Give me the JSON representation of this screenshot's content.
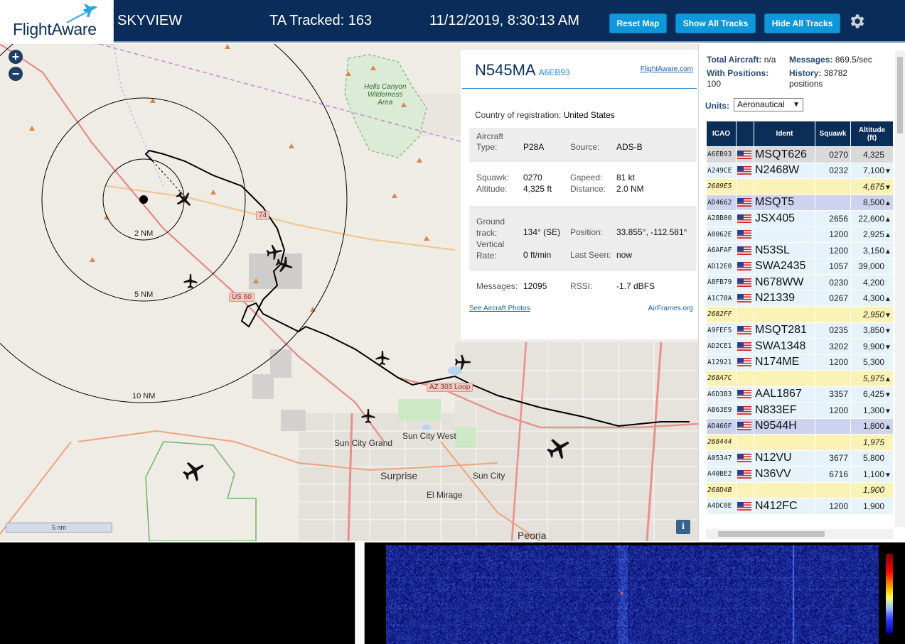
{
  "header": {
    "logo_text": "FlightAware",
    "app_name": "SKYVIEW",
    "tracked": "TA Tracked: 163",
    "datetime": "11/12/2019, 8:30:13 AM",
    "buttons": {
      "reset_map": "Reset Map",
      "show_all": "Show All Tracks",
      "hide_all": "Hide All Tracks"
    },
    "settings_icon": "gear-icon",
    "colors": {
      "bar": "#0a2c5a",
      "button": "#0f97dc"
    }
  },
  "map": {
    "zoom_in": "+",
    "zoom_out": "−",
    "range_rings": [
      "2 NM",
      "5 NM",
      "10 NM"
    ],
    "scale_label": "5 nm",
    "info_icon": "i",
    "labels": {
      "wilderness": "Hells Canyon\nWilderness\nArea",
      "sun_city_west": "Sun City West",
      "sun_city_grand": "Sun City Grand",
      "surprise": "Surprise",
      "sun_city": "Sun City",
      "el_mirage": "El Mirage",
      "peoria": "Peoria",
      "us60": "US 60",
      "az303": "AZ 303 Loop",
      "sr74": "74"
    }
  },
  "detail": {
    "callsign": "N545MA",
    "icao": "A6EB93",
    "link": "FlightAware.com",
    "country_label": "Country of registration:",
    "country": "United States",
    "aircraft_type_label": "Aircraft\nType:",
    "aircraft_type": "P28A",
    "source_label": "Source:",
    "source": "ADS-B",
    "squawk_label": "Squawk:",
    "squawk": "0270",
    "gspeed_label": "Gspeed:",
    "gspeed": "81 kt",
    "altitude_label": "Altitude:",
    "altitude": "4,325 ft",
    "distance_label": "Distance:",
    "distance": "2.0 NM",
    "ground_track_label": "Ground\ntrack:",
    "ground_track": "134° (SE)",
    "position_label": "Position:",
    "position": "33.855°, -112.581°",
    "vertical_rate_label": "Vertical\nRate:",
    "vertical_rate": "0 ft/min",
    "last_seen_label": "Last Seen:",
    "last_seen": "now",
    "messages_label": "Messages:",
    "messages": "12095",
    "rssi_label": "RSSI:",
    "rssi": "-1.7 dBFS",
    "photos_link": "See Aircraft Photos",
    "airframes_link": "AirFrames.org"
  },
  "sidebar": {
    "total_aircraft_label": "Total Aircraft:",
    "total_aircraft": "n/a",
    "messages_label": "Messages:",
    "messages": "869.5/sec",
    "with_positions_label": "With Positions:",
    "with_positions": "100",
    "history_label": "History:",
    "history": "38782\npositions",
    "units_label": "Units:",
    "units_value": "Aeronautical",
    "columns": [
      "ICAO",
      "",
      "Ident",
      "Squawk",
      "Altitude\n(ft)"
    ],
    "rows": [
      {
        "icao": "A6EB93",
        "flag": true,
        "ident": "MSQT626",
        "squawk": "0270",
        "alt": "4,325",
        "trend": "",
        "style": "sel"
      },
      {
        "icao": "A249CE",
        "flag": true,
        "ident": "N2468W",
        "squawk": "0232",
        "alt": "7,100",
        "trend": "▼",
        "style": "plain"
      },
      {
        "icao": "2689E5",
        "flag": false,
        "ident": "",
        "squawk": "",
        "alt": "4,675",
        "trend": "▼",
        "style": "yellow"
      },
      {
        "icao": "AD4662",
        "flag": true,
        "ident": "MSQT5",
        "squawk": "",
        "alt": "8,500",
        "trend": "▲",
        "style": "mlat"
      },
      {
        "icao": "A28B00",
        "flag": true,
        "ident": "JSX405",
        "squawk": "2656",
        "alt": "22,600",
        "trend": "▲",
        "style": "plain"
      },
      {
        "icao": "A0062E",
        "flag": true,
        "ident": "",
        "squawk": "1200",
        "alt": "2,925",
        "trend": "▲",
        "style": "plain"
      },
      {
        "icao": "A6AFAF",
        "flag": true,
        "ident": "N53SL",
        "squawk": "1200",
        "alt": "3,150",
        "trend": "▲",
        "style": "plain"
      },
      {
        "icao": "AD12E0",
        "flag": true,
        "ident": "SWA2435",
        "squawk": "1057",
        "alt": "39,000",
        "trend": "",
        "style": "plain"
      },
      {
        "icao": "A8FB79",
        "flag": true,
        "ident": "N678WW",
        "squawk": "0230",
        "alt": "4,200",
        "trend": "",
        "style": "plain"
      },
      {
        "icao": "A1C78A",
        "flag": true,
        "ident": "N21339",
        "squawk": "0267",
        "alt": "4,300",
        "trend": "▲",
        "style": "plain"
      },
      {
        "icao": "2682FF",
        "flag": false,
        "ident": "",
        "squawk": "",
        "alt": "2,950",
        "trend": "▼",
        "style": "yellow"
      },
      {
        "icao": "A9FEF5",
        "flag": true,
        "ident": "MSQT281",
        "squawk": "0235",
        "alt": "3,850",
        "trend": "▼",
        "style": "plain"
      },
      {
        "icao": "AD2CE1",
        "flag": true,
        "ident": "SWA1348",
        "squawk": "3202",
        "alt": "9,900",
        "trend": "▼",
        "style": "plain"
      },
      {
        "icao": "A12921",
        "flag": true,
        "ident": "N174ME",
        "squawk": "1200",
        "alt": "5,300",
        "trend": "",
        "style": "plain"
      },
      {
        "icao": "268A7C",
        "flag": false,
        "ident": "",
        "squawk": "",
        "alt": "5,975",
        "trend": "▲",
        "style": "yellow"
      },
      {
        "icao": "A6D3B3",
        "flag": true,
        "ident": "AAL1867",
        "squawk": "3357",
        "alt": "6,425",
        "trend": "▼",
        "style": "plain"
      },
      {
        "icao": "AB63E9",
        "flag": true,
        "ident": "N833EF",
        "squawk": "1200",
        "alt": "1,300",
        "trend": "▼",
        "style": "plain"
      },
      {
        "icao": "AD466F",
        "flag": true,
        "ident": "N9544H",
        "squawk": "",
        "alt": "1,800",
        "trend": "▲",
        "style": "mlat"
      },
      {
        "icao": "268444",
        "flag": false,
        "ident": "",
        "squawk": "",
        "alt": "1,975",
        "trend": "",
        "style": "yellow"
      },
      {
        "icao": "A05347",
        "flag": true,
        "ident": "N12VU",
        "squawk": "3677",
        "alt": "5,800",
        "trend": "",
        "style": "plain"
      },
      {
        "icao": "A40BE2",
        "flag": true,
        "ident": "N36VV",
        "squawk": "6716",
        "alt": "1,100",
        "trend": "▼",
        "style": "plain"
      },
      {
        "icao": "268D4B",
        "flag": false,
        "ident": "",
        "squawk": "",
        "alt": "1,900",
        "trend": "",
        "style": "yellow"
      },
      {
        "icao": "A4DC0E",
        "flag": true,
        "ident": "N412FC",
        "squawk": "1200",
        "alt": "1,900",
        "trend": "",
        "style": "plain"
      }
    ]
  }
}
